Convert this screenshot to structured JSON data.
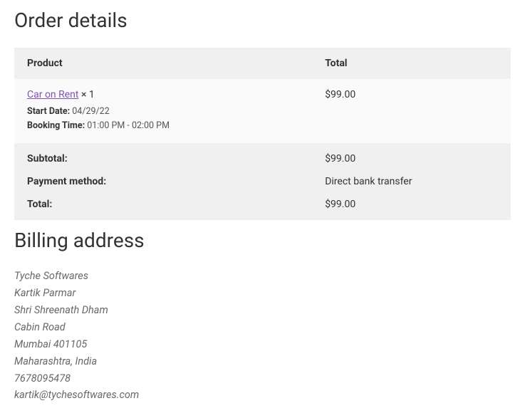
{
  "order": {
    "heading": "Order details",
    "columns": {
      "product": "Product",
      "total": "Total"
    },
    "item": {
      "name": "Car on Rent",
      "qty": "× 1",
      "start_date_label": "Start Date:",
      "start_date_value": "04/29/22",
      "booking_time_label": "Booking Time:",
      "booking_time_value": "01:00 PM - 02:00 PM",
      "line_total": "$99.00"
    },
    "subtotal_label": "Subtotal:",
    "subtotal_value": "$99.00",
    "payment_method_label": "Payment method:",
    "payment_method_value": "Direct bank transfer",
    "total_label": "Total:",
    "total_value": "$99.00"
  },
  "billing": {
    "heading": "Billing address",
    "lines": {
      "l1": "Tyche Softwares",
      "l2": "Kartik Parmar",
      "l3": "Shri Shreenath Dham",
      "l4": "Cabin Road",
      "l5": "Mumbai 401105",
      "l6": "Maharashtra, India",
      "l7": "7678095478"
    },
    "email": "kartik@tychesoftwares.com"
  }
}
